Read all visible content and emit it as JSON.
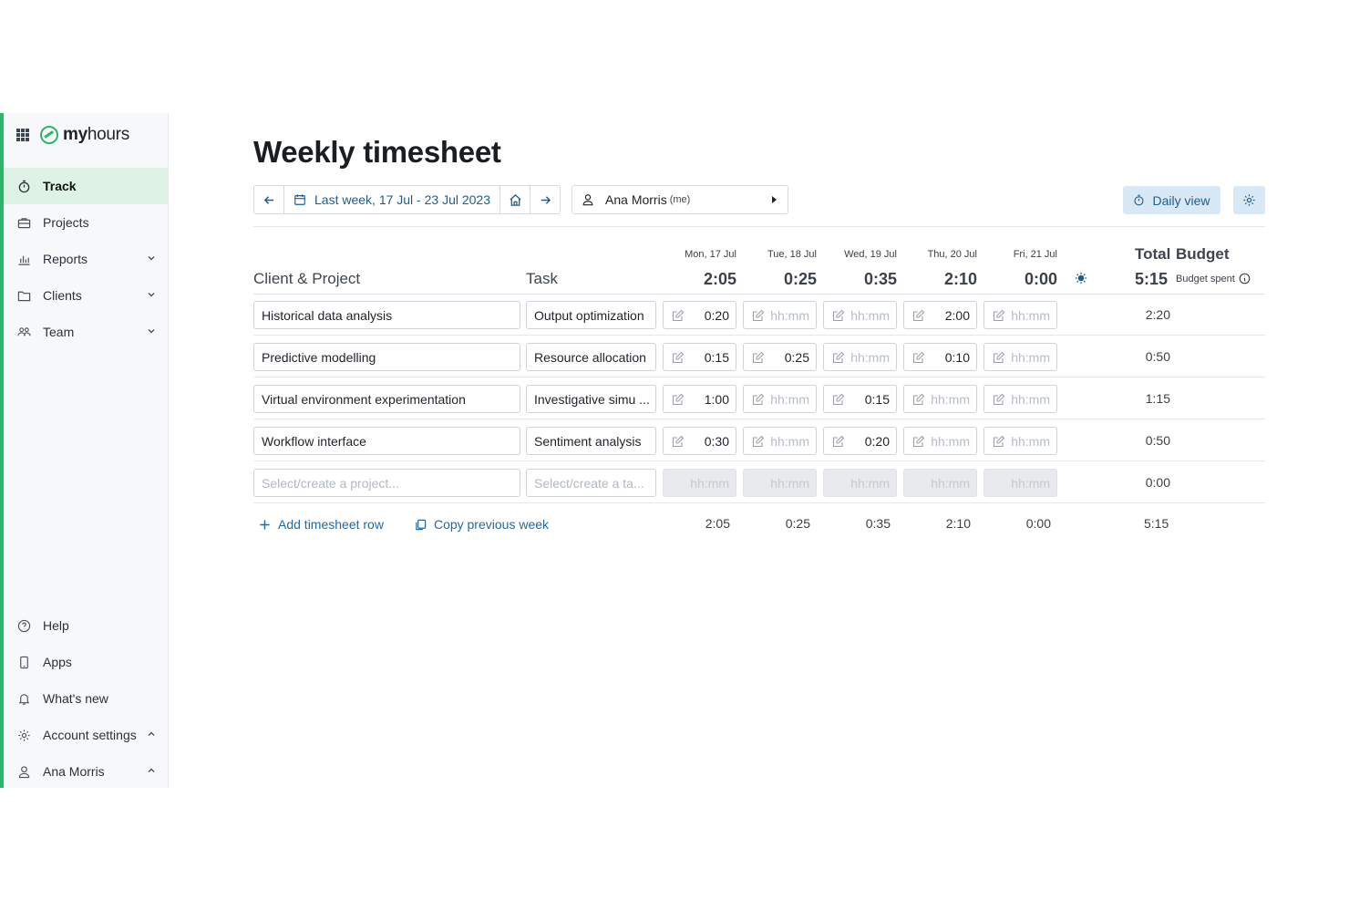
{
  "app": {
    "logo_bold": "my",
    "logo_rest": "hours"
  },
  "sidebar": {
    "nav": [
      {
        "label": "Track",
        "icon": "stopwatch-icon",
        "active": true
      },
      {
        "label": "Projects",
        "icon": "briefcase-icon"
      },
      {
        "label": "Reports",
        "icon": "bar-chart-icon",
        "expandable": true
      },
      {
        "label": "Clients",
        "icon": "folder-icon",
        "expandable": true
      },
      {
        "label": "Team",
        "icon": "people-icon",
        "expandable": true
      }
    ],
    "bottom": [
      {
        "label": "Help",
        "icon": "help-icon"
      },
      {
        "label": "Apps",
        "icon": "phone-icon"
      },
      {
        "label": "What's new",
        "icon": "bell-icon"
      },
      {
        "label": "Account settings",
        "icon": "gear-icon",
        "expanded": true
      },
      {
        "label": "Ana Morris",
        "icon": "user-icon",
        "expanded": true
      }
    ]
  },
  "page": {
    "title": "Weekly timesheet"
  },
  "toolbar": {
    "date_range": "Last week, 17 Jul - 23 Jul 2023",
    "user_name": "Ana Morris",
    "user_suffix": "(me)",
    "daily_view_label": "Daily view"
  },
  "table": {
    "col_client_project": "Client & Project",
    "col_task": "Task",
    "col_total": "Total",
    "col_budget": "Budget",
    "budget_spent_label": "Budget spent",
    "week_total": "5:15",
    "days": [
      {
        "label": "Mon, 17 Jul",
        "total": "2:05"
      },
      {
        "label": "Tue, 18 Jul",
        "total": "0:25"
      },
      {
        "label": "Wed, 19 Jul",
        "total": "0:35"
      },
      {
        "label": "Thu, 20 Jul",
        "total": "2:10"
      },
      {
        "label": "Fri, 21 Jul",
        "total": "0:00"
      }
    ],
    "time_placeholder": "hh:mm",
    "rows": [
      {
        "project": "Historical data analysis",
        "task": "Output optimization",
        "times": [
          "0:20",
          "",
          "",
          "2:00",
          ""
        ],
        "total": "2:20"
      },
      {
        "project": "Predictive modelling",
        "task": "Resource allocation",
        "times": [
          "0:15",
          "0:25",
          "",
          "0:10",
          ""
        ],
        "total": "0:50"
      },
      {
        "project": "Virtual environment experimentation",
        "task": "Investigative simu ...",
        "times": [
          "1:00",
          "",
          "0:15",
          "",
          ""
        ],
        "total": "1:15"
      },
      {
        "project": "Workflow interface",
        "task": "Sentiment analysis",
        "times": [
          "0:30",
          "",
          "0:20",
          "",
          ""
        ],
        "total": "0:50"
      }
    ],
    "new_row": {
      "project_placeholder": "Select/create a project...",
      "task_placeholder": "Select/create a ta...",
      "total": "0:00"
    },
    "footer": {
      "add_row_label": "Add timesheet row",
      "copy_week_label": "Copy previous week",
      "day_totals": [
        "2:05",
        "0:25",
        "0:35",
        "2:10",
        "0:00"
      ],
      "week_total": "5:15"
    }
  },
  "colors": {
    "brand_green": "#2fb56a",
    "active_nav_bg": "#dff2e6",
    "link_blue": "#1f6aa5",
    "daily_btn_bg": "#d8e8f5"
  }
}
